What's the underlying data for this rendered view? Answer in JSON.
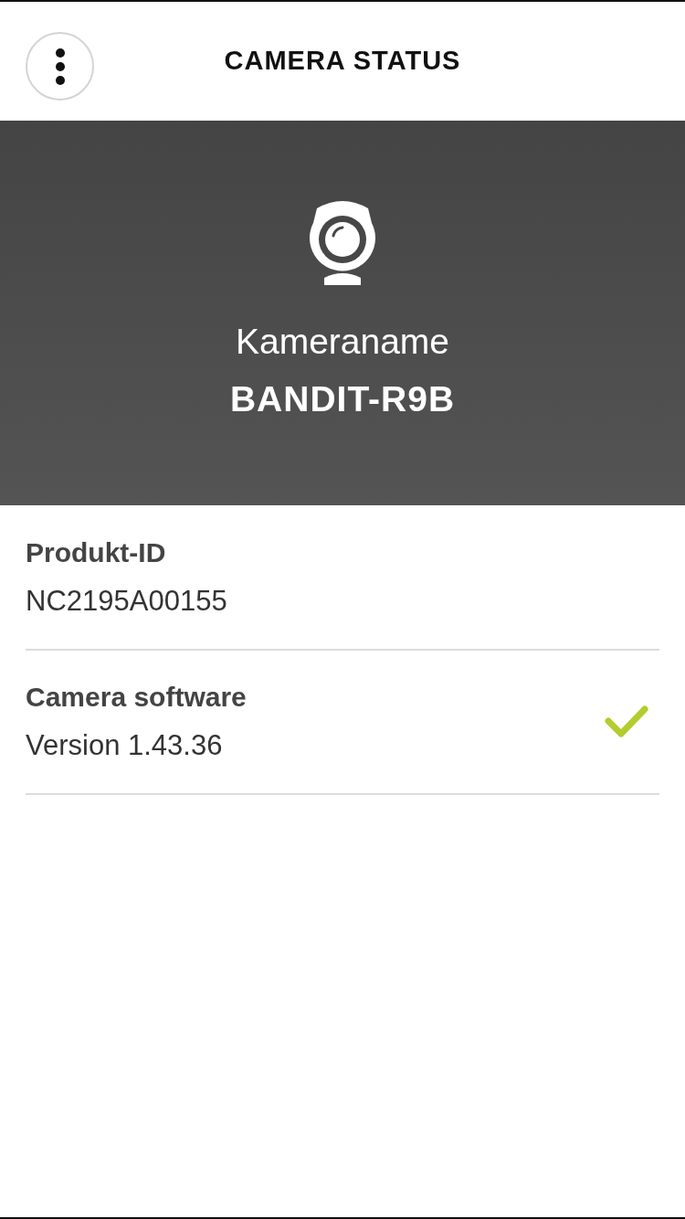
{
  "header": {
    "title": "CAMERA STATUS"
  },
  "camera": {
    "label": "Kameraname",
    "name": "BANDIT-R9B"
  },
  "info_rows": [
    {
      "label": "Produkt-ID",
      "value": "NC2195A00155",
      "up_to_date": false
    },
    {
      "label": "Camera software",
      "value": "Version 1.43.36",
      "up_to_date": true
    }
  ]
}
